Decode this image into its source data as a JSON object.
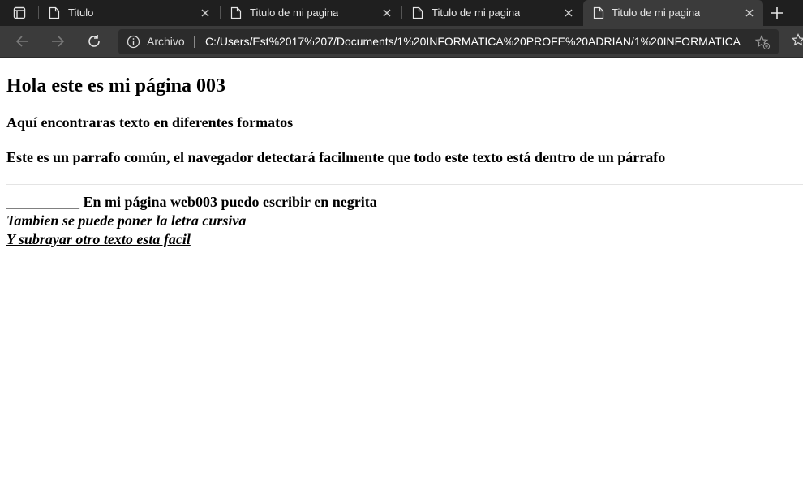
{
  "browser": {
    "tabs": [
      {
        "title": "Titulo",
        "active": false
      },
      {
        "title": "Titulo de mi pagina",
        "active": false
      },
      {
        "title": "Titulo de mi pagina",
        "active": false
      },
      {
        "title": "Titulo de mi pagina",
        "active": true
      }
    ],
    "address": {
      "scheme_label": "Archivo",
      "url": "C:/Users/Est%2017%207/Documents/1%20INFORMATICA%20PROFE%20ADRIAN/1%20INFORMATICA%2..."
    },
    "colors": {
      "tabstrip_bg": "#1f1f1f",
      "toolbar_bg": "#3b3b3b",
      "omnibox_bg": "#2b2b2b"
    }
  },
  "page": {
    "heading": "Hola este es mi página 003",
    "subheading": "Aquí encontraras texto en diferentes formatos",
    "paragraph": "Este es un parrafo común, el navegador detectará facilmente que todo este texto está dentro de un párrafo",
    "bold_line": "__________ En mi página web003 puedo escribir en negrita",
    "italic_line": "Tambien se puede poner la letra cursiva",
    "underline_line": "Y subrayar otro texto esta facil"
  }
}
